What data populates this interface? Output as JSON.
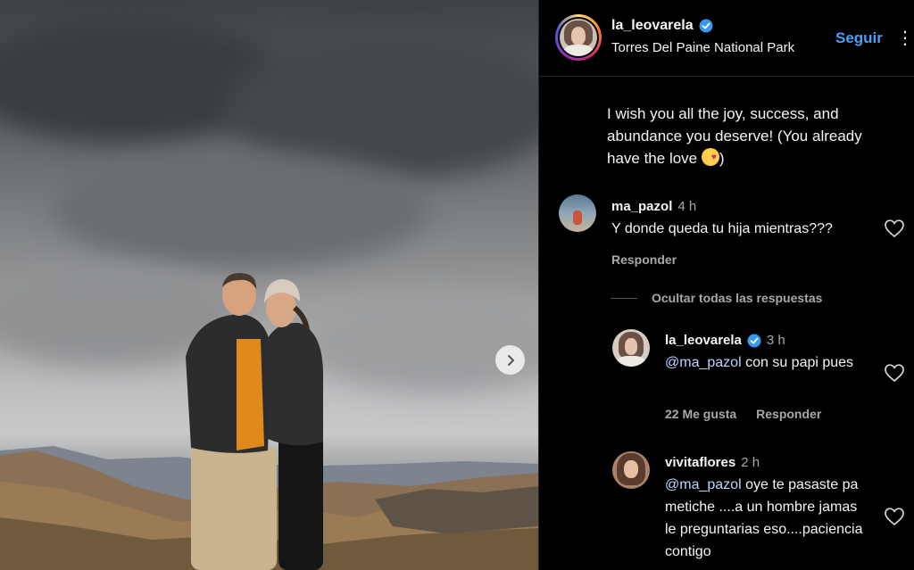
{
  "post": {
    "next_button_icon": "chevron-right-icon"
  },
  "header": {
    "username": "la_leovarela",
    "location": "Torres Del Paine National Park",
    "follow_label": "Seguir",
    "more_label": "⋮"
  },
  "caption": {
    "text": "I wish you all the joy, success, and abundance you deserve! (You already have the love",
    "close": ")"
  },
  "comments": [
    {
      "username": "ma_pazol",
      "time": "4 h",
      "text": "Y donde queda tu hija mientras???",
      "reply_label": "Responder",
      "hide_replies_label": "Ocultar todas las respuestas"
    }
  ],
  "replies": [
    {
      "username": "la_leovarela",
      "time": "3 h",
      "mention": "@ma_pazol",
      "text": "con su papi pues",
      "likes_label": "22 Me gusta",
      "reply_label": "Responder"
    },
    {
      "username": "vivitaflores",
      "time": "2 h",
      "mention": "@ma_pazol",
      "text": "oye te pasaste pa metiche ....a un hombre jamas le preguntarias eso....paciencia contigo"
    }
  ],
  "colors": {
    "accent": "#4a9ef7",
    "background": "#000000",
    "muted_text": "#a8a8a8",
    "verified_badge": "#3897f0"
  }
}
